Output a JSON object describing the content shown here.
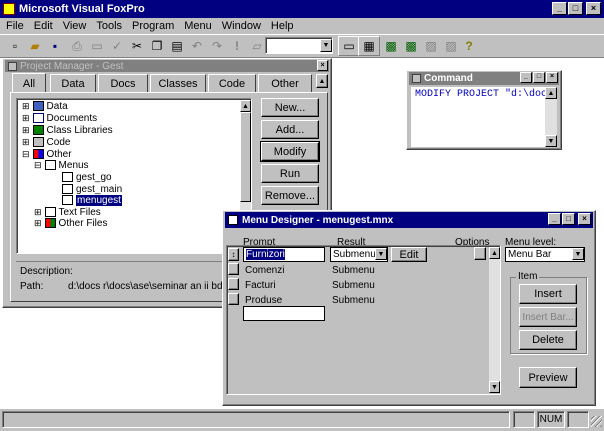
{
  "app": {
    "title": "Microsoft Visual FoxPro"
  },
  "menubar": {
    "items": [
      "File",
      "Edit",
      "View",
      "Tools",
      "Program",
      "Menu",
      "Window",
      "Help"
    ]
  },
  "toolbar": {
    "combo_value": ""
  },
  "project_manager": {
    "title": "Project Manager - Gest",
    "tabs": [
      "All",
      "Data",
      "Docs",
      "Classes",
      "Code",
      "Other"
    ],
    "tree": {
      "data": "Data",
      "documents": "Documents",
      "class_libraries": "Class Libraries",
      "code": "Code",
      "other": "Other",
      "menus": "Menus",
      "gest_go": "gest_go",
      "gest_main": "gest_main",
      "menugest": "menugest",
      "text_files": "Text Files",
      "other_files": "Other Files"
    },
    "buttons": {
      "new": "New...",
      "add": "Add...",
      "modify": "Modify",
      "run": "Run",
      "remove": "Remove..."
    },
    "description_label": "Description:",
    "path_label": "Path:",
    "path_value": "d:\\docs r\\docs\\ase\\seminar an ii bd\\gest\\"
  },
  "command": {
    "title": "Command",
    "text": "MODIFY PROJECT \"d:\\doc"
  },
  "menu_designer": {
    "title": "Menu Designer - menugest.mnx",
    "headers": {
      "prompt": "Prompt",
      "result": "Result",
      "options": "Options",
      "menu_level": "Menu level:"
    },
    "rows": [
      {
        "prompt": "Furnizori",
        "result": "Submenu"
      },
      {
        "prompt": "Comenzi",
        "result": "Submenu"
      },
      {
        "prompt": "Facturi",
        "result": "Submenu"
      },
      {
        "prompt": "Produse",
        "result": "Submenu"
      }
    ],
    "edit_button": "Edit",
    "menu_level_value": "Menu Bar",
    "item_group": "Item",
    "buttons": {
      "insert": "Insert",
      "insert_bar": "Insert Bar...",
      "delete": "Delete",
      "preview": "Preview"
    }
  },
  "statusbar": {
    "num": "NUM"
  }
}
